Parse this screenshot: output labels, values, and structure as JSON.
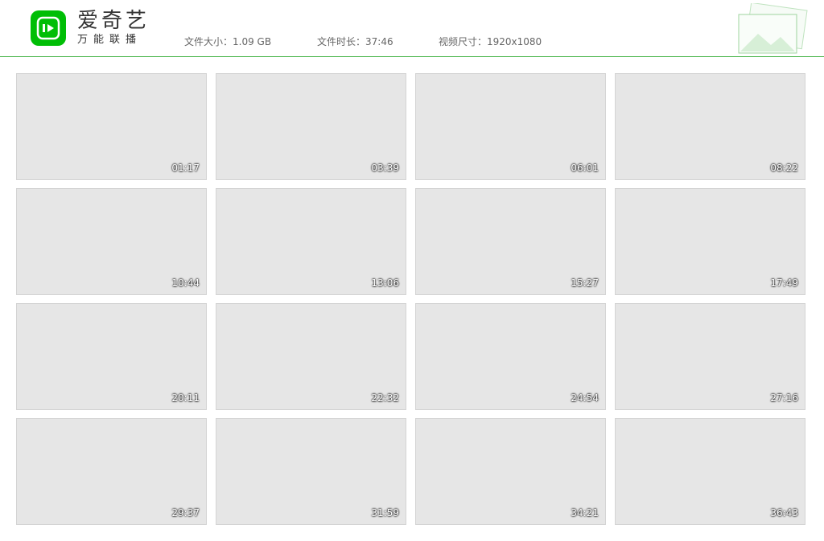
{
  "brand": {
    "title": "爱奇艺",
    "subtitle": "万能联播",
    "accent": "#00be06"
  },
  "file": {
    "size_label": "文件大小：1.09 GB",
    "duration_label": "文件时长：37:46",
    "resolution_label": "视频尺寸：1920x1080"
  },
  "thumbnails": [
    {
      "time": "01:17"
    },
    {
      "time": "03:39"
    },
    {
      "time": "06:01"
    },
    {
      "time": "08:22"
    },
    {
      "time": "10:44"
    },
    {
      "time": "13:06"
    },
    {
      "time": "15:27"
    },
    {
      "time": "17:49"
    },
    {
      "time": "20:11"
    },
    {
      "time": "22:32"
    },
    {
      "time": "24:54"
    },
    {
      "time": "27:16"
    },
    {
      "time": "29:37"
    },
    {
      "time": "31:59"
    },
    {
      "time": "34:21"
    },
    {
      "time": "36:43"
    }
  ]
}
